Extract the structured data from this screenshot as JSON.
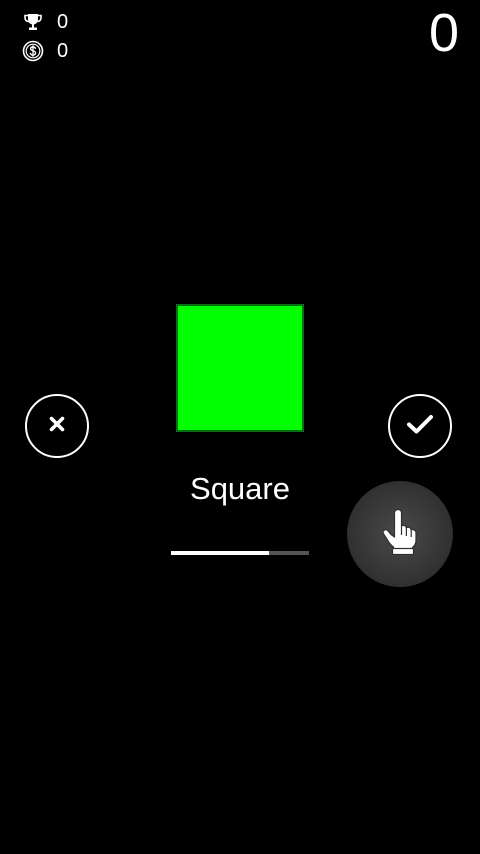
{
  "stats": {
    "trophies": "0",
    "coins": "0"
  },
  "score": "0",
  "shape": {
    "name": "Square",
    "fill_color": "#00ff00"
  },
  "timer": {
    "progress": 0.71
  },
  "icons": {
    "trophy": "trophy-icon",
    "coin": "dollar-coin-icon",
    "reject": "close-icon",
    "accept": "checkmark-icon",
    "tap": "pointing-hand-icon"
  }
}
